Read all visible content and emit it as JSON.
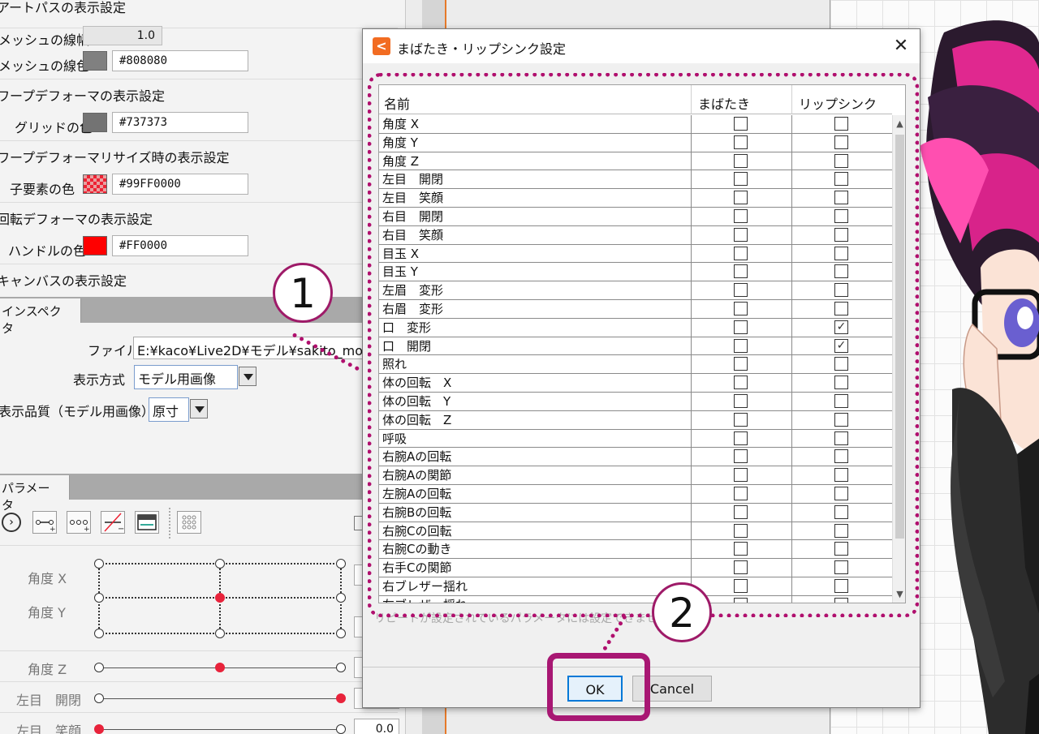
{
  "inspector": {
    "art_path_section": "アートパスの表示設定",
    "mesh_width_label": "メッシュの線幅",
    "mesh_width_value": "1.0",
    "mesh_color_label": "メッシュの線色",
    "mesh_color_hex": "#808080",
    "warp_section": "ワープデフォーマの表示設定",
    "grid_color_label": "グリッドの色",
    "grid_color_hex": "#737373",
    "warp_resize_section": "ワープデフォーマリサイズ時の表示設定",
    "child_color_label": "子要素の色",
    "child_color_hex": "#99FF0000",
    "rotation_section": "回転デフォーマの表示設定",
    "handle_color_label": "ハンドルの色",
    "handle_color_hex": "#FF0000",
    "canvas_section": "キャンバスの表示設定",
    "tab_inspector": "インスペクタ",
    "file_label": "ファイル",
    "file_value": "E:¥kaco¥Live2D¥モデル¥sakito_mo",
    "display_mode_label": "表示方式",
    "display_mode_value": "モデル用画像",
    "quality_label": "表示品質（モデル用画像）",
    "quality_value": "原寸"
  },
  "parameters": {
    "tab_label": "パラメータ",
    "rows": [
      {
        "label": "角度 X"
      },
      {
        "label": "角度 Y"
      },
      {
        "label": "角度 Z"
      },
      {
        "label": "左目　開閉"
      },
      {
        "label": "左目　笑顔",
        "value": "0.0"
      }
    ]
  },
  "dialog": {
    "title": "まばたき・リップシンク設定",
    "close_glyph": "✕",
    "columns": [
      "名前",
      "まばたき",
      "リップシンク"
    ],
    "rows": [
      {
        "name": "角度 X",
        "blink": false,
        "lip": false
      },
      {
        "name": "角度 Y",
        "blink": false,
        "lip": false
      },
      {
        "name": "角度 Z",
        "blink": false,
        "lip": false
      },
      {
        "name": "左目　開閉",
        "blink": false,
        "lip": false
      },
      {
        "name": "左目　笑顔",
        "blink": false,
        "lip": false
      },
      {
        "name": "右目　開閉",
        "blink": false,
        "lip": false
      },
      {
        "name": "右目　笑顔",
        "blink": false,
        "lip": false
      },
      {
        "name": "目玉 X",
        "blink": false,
        "lip": false
      },
      {
        "name": "目玉 Y",
        "blink": false,
        "lip": false
      },
      {
        "name": "左眉　変形",
        "blink": false,
        "lip": false
      },
      {
        "name": "右眉　変形",
        "blink": false,
        "lip": false
      },
      {
        "name": "口　変形",
        "blink": false,
        "lip": true
      },
      {
        "name": "口　開閉",
        "blink": false,
        "lip": true
      },
      {
        "name": "照れ",
        "blink": false,
        "lip": false
      },
      {
        "name": "体の回転　X",
        "blink": false,
        "lip": false
      },
      {
        "name": "体の回転　Y",
        "blink": false,
        "lip": false
      },
      {
        "name": "体の回転　Z",
        "blink": false,
        "lip": false
      },
      {
        "name": "呼吸",
        "blink": false,
        "lip": false
      },
      {
        "name": "右腕Aの回転",
        "blink": false,
        "lip": false
      },
      {
        "name": "右腕Aの関節",
        "blink": false,
        "lip": false
      },
      {
        "name": "左腕Aの回転",
        "blink": false,
        "lip": false
      },
      {
        "name": "右腕Bの回転",
        "blink": false,
        "lip": false
      },
      {
        "name": "右腕Cの回転",
        "blink": false,
        "lip": false
      },
      {
        "name": "右腕Cの動き",
        "blink": false,
        "lip": false
      },
      {
        "name": "右手Cの関節",
        "blink": false,
        "lip": false
      },
      {
        "name": "右ブレザー揺れ",
        "blink": false,
        "lip": false
      },
      {
        "name": "左ブレザー揺れ",
        "blink": false,
        "lip": false
      }
    ],
    "note": "リピートが設定されているパラメータには設定できません",
    "ok_label": "OK",
    "cancel_label": "Cancel"
  },
  "annotations": {
    "marker_1": "1",
    "marker_2": "2"
  },
  "colors": {
    "accent_magenta": "#b0106e",
    "mesh": "#808080",
    "grid": "#737373",
    "handle": "#FF0000",
    "app_icon": "#f26c22"
  }
}
